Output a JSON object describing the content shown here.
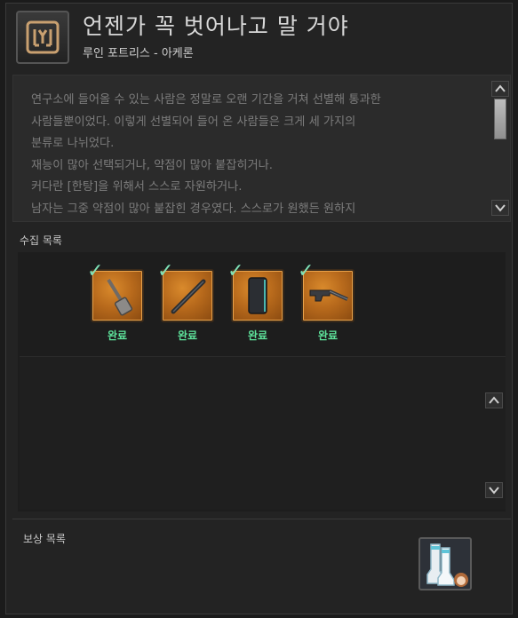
{
  "header": {
    "icon": "ruin-emblem-icon",
    "title": "언젠가 꼭 벗어나고 말 거야",
    "subtitle": "루인 포트리스 - 아케론"
  },
  "description": {
    "lines": [
      "연구소에 들어올 수 있는 사람은 정말로 오랜 기간을 거쳐 선별해 통과한",
      "사람들뿐이었다. 이렇게 선별되어 들어 온 사람들은 크게 세 가지의",
      "분류로 나뉘었다.",
      "재능이 많아 선택되거나, 약점이 많아 붙잡히거나.",
      "커다란 [한탕]을 위해서 스스로 자원하거나.",
      "남자는 그중 약점이 많아 붙잡힌 경우였다. 스스로가 원했든 원하지"
    ]
  },
  "collection": {
    "label": "수집 목록",
    "items": [
      {
        "icon": "shovel-item-icon",
        "status": "완료"
      },
      {
        "icon": "staff-item-icon",
        "status": "완료"
      },
      {
        "icon": "tablet-item-icon",
        "status": "완료"
      },
      {
        "icon": "rifle-item-icon",
        "status": "완료"
      }
    ]
  },
  "reward": {
    "label": "보상 목록",
    "items": [
      {
        "icon": "boots-reward-icon"
      }
    ]
  },
  "colors": {
    "accent_complete": "#5ee39b",
    "check": "#7fe3b8",
    "item_bg": "#c17a25"
  }
}
